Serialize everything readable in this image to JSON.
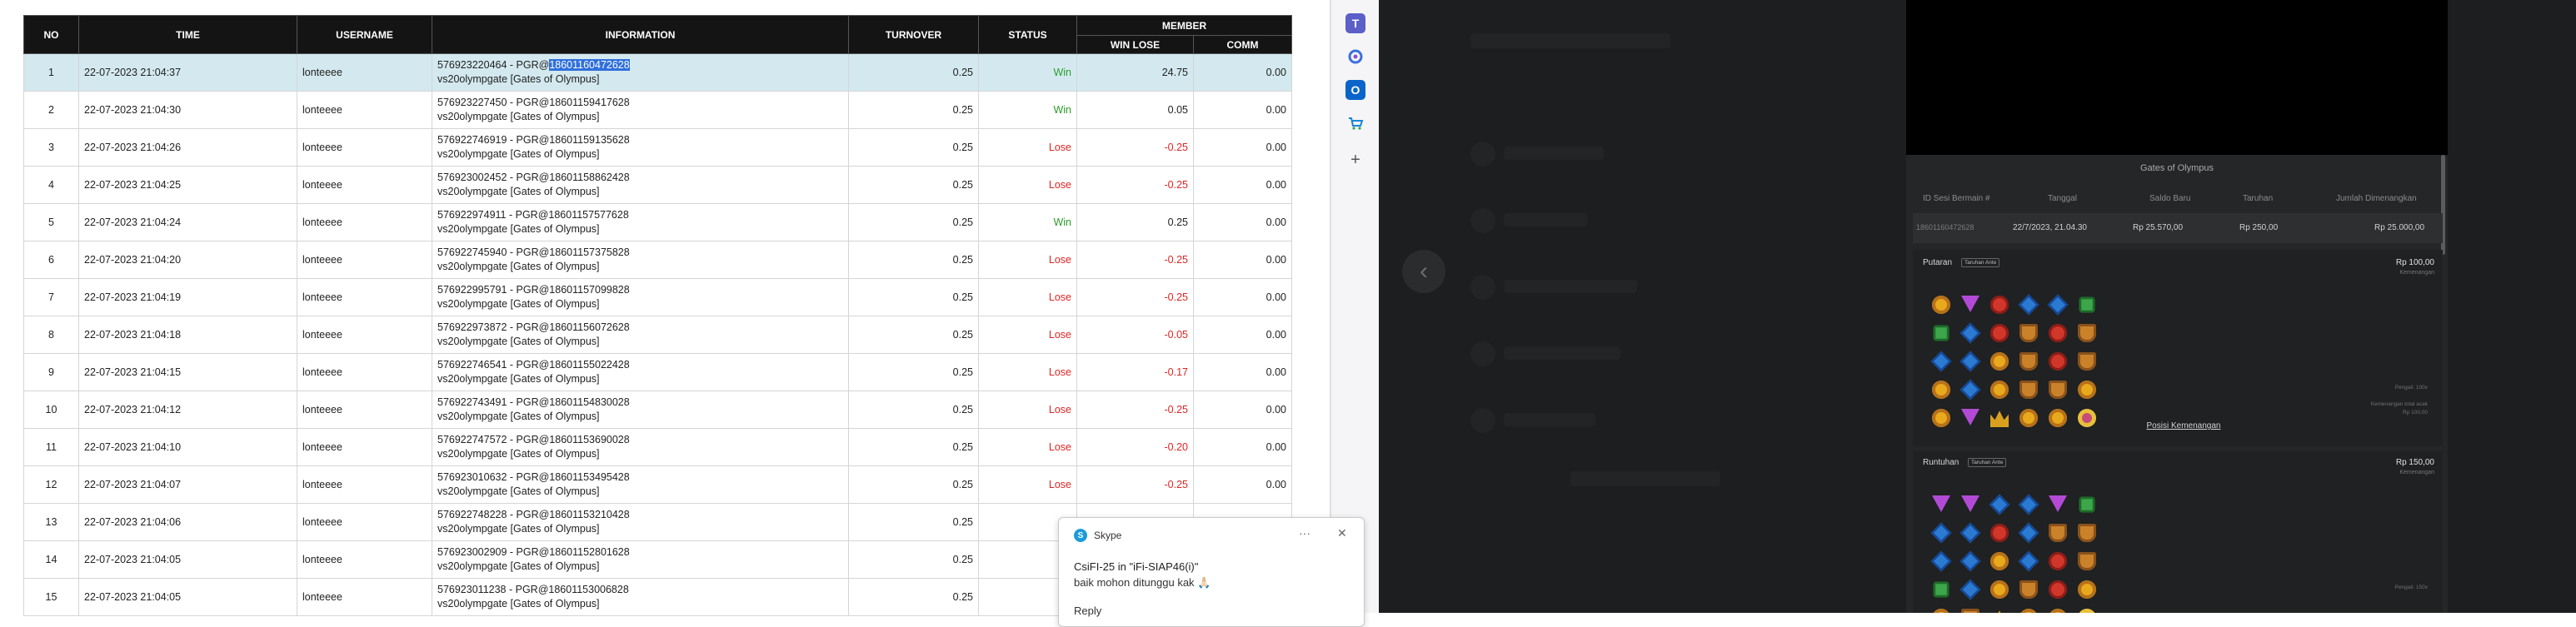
{
  "report": {
    "headers": {
      "no": "NO",
      "time": "TIME",
      "username": "USERNAME",
      "information": "INFORMATION",
      "turnover": "TURNOVER",
      "status": "STATUS",
      "member": "MEMBER",
      "win_lose": "WIN LOSE",
      "comm": "COMM"
    },
    "rows": [
      {
        "no": "1",
        "time": "22-07-2023 21:04:37",
        "username": "lonteeee",
        "info_prefix": "576923220464 - PGR@",
        "info_highlight": "18601160472628",
        "info_line2": "vs20olympgate [Gates of Olympus]",
        "turnover": "0.25",
        "status": "Win",
        "win_lose": "24.75",
        "comm": "0.00"
      },
      {
        "no": "2",
        "time": "22-07-2023 21:04:30",
        "username": "lonteeee",
        "info_prefix": "576923227450 - PGR@18601159417628",
        "info_highlight": "",
        "info_line2": "vs20olympgate [Gates of Olympus]",
        "turnover": "0.25",
        "status": "Win",
        "win_lose": "0.05",
        "comm": "0.00"
      },
      {
        "no": "3",
        "time": "22-07-2023 21:04:26",
        "username": "lonteeee",
        "info_prefix": "576922746919 - PGR@18601159135628",
        "info_highlight": "",
        "info_line2": "vs20olympgate [Gates of Olympus]",
        "turnover": "0.25",
        "status": "Lose",
        "win_lose": "-0.25",
        "comm": "0.00"
      },
      {
        "no": "4",
        "time": "22-07-2023 21:04:25",
        "username": "lonteeee",
        "info_prefix": "576923002452 - PGR@18601158862428",
        "info_highlight": "",
        "info_line2": "vs20olympgate [Gates of Olympus]",
        "turnover": "0.25",
        "status": "Lose",
        "win_lose": "-0.25",
        "comm": "0.00"
      },
      {
        "no": "5",
        "time": "22-07-2023 21:04:24",
        "username": "lonteeee",
        "info_prefix": "576922974911 - PGR@18601157577628",
        "info_highlight": "",
        "info_line2": "vs20olympgate [Gates of Olympus]",
        "turnover": "0.25",
        "status": "Win",
        "win_lose": "0.25",
        "comm": "0.00"
      },
      {
        "no": "6",
        "time": "22-07-2023 21:04:20",
        "username": "lonteeee",
        "info_prefix": "576922745940 - PGR@18601157375828",
        "info_highlight": "",
        "info_line2": "vs20olympgate [Gates of Olympus]",
        "turnover": "0.25",
        "status": "Lose",
        "win_lose": "-0.25",
        "comm": "0.00"
      },
      {
        "no": "7",
        "time": "22-07-2023 21:04:19",
        "username": "lonteeee",
        "info_prefix": "576922995791 - PGR@18601157099828",
        "info_highlight": "",
        "info_line2": "vs20olympgate [Gates of Olympus]",
        "turnover": "0.25",
        "status": "Lose",
        "win_lose": "-0.25",
        "comm": "0.00"
      },
      {
        "no": "8",
        "time": "22-07-2023 21:04:18",
        "username": "lonteeee",
        "info_prefix": "576922973872 - PGR@18601156072628",
        "info_highlight": "",
        "info_line2": "vs20olympgate [Gates of Olympus]",
        "turnover": "0.25",
        "status": "Lose",
        "win_lose": "-0.05",
        "comm": "0.00"
      },
      {
        "no": "9",
        "time": "22-07-2023 21:04:15",
        "username": "lonteeee",
        "info_prefix": "576922746541 - PGR@18601155022428",
        "info_highlight": "",
        "info_line2": "vs20olympgate [Gates of Olympus]",
        "turnover": "0.25",
        "status": "Lose",
        "win_lose": "-0.17",
        "comm": "0.00"
      },
      {
        "no": "10",
        "time": "22-07-2023 21:04:12",
        "username": "lonteeee",
        "info_prefix": "576922743491 - PGR@18601154830028",
        "info_highlight": "",
        "info_line2": "vs20olympgate [Gates of Olympus]",
        "turnover": "0.25",
        "status": "Lose",
        "win_lose": "-0.25",
        "comm": "0.00"
      },
      {
        "no": "11",
        "time": "22-07-2023 21:04:10",
        "username": "lonteeee",
        "info_prefix": "576922747572 - PGR@18601153690028",
        "info_highlight": "",
        "info_line2": "vs20olympgate [Gates of Olympus]",
        "turnover": "0.25",
        "status": "Lose",
        "win_lose": "-0.20",
        "comm": "0.00"
      },
      {
        "no": "12",
        "time": "22-07-2023 21:04:07",
        "username": "lonteeee",
        "info_prefix": "576923010632 - PGR@18601153495428",
        "info_highlight": "",
        "info_line2": "vs20olympgate [Gates of Olympus]",
        "turnover": "0.25",
        "status": "Lose",
        "win_lose": "-0.25",
        "comm": "0.00"
      },
      {
        "no": "13",
        "time": "22-07-2023 21:04:06",
        "username": "lonteeee",
        "info_prefix": "576922748228 - PGR@18601153210428",
        "info_highlight": "",
        "info_line2": "vs20olympgate [Gates of Olympus]",
        "turnover": "0.25",
        "status": "L",
        "win_lose": "",
        "comm": ""
      },
      {
        "no": "14",
        "time": "22-07-2023 21:04:05",
        "username": "lonteeee",
        "info_prefix": "576923002909 - PGR@18601152801628",
        "info_highlight": "",
        "info_line2": "vs20olympgate [Gates of Olympus]",
        "turnover": "0.25",
        "status": "L",
        "win_lose": "",
        "comm": ""
      },
      {
        "no": "15",
        "time": "22-07-2023 21:04:05",
        "username": "lonteeee",
        "info_prefix": "576923011238 - PGR@18601153006828",
        "info_highlight": "",
        "info_line2": "vs20olympgate [Gates of Olympus]",
        "turnover": "0.25",
        "status": "L",
        "win_lose": "",
        "comm": ""
      }
    ]
  },
  "sidebar": {
    "icons": [
      "teams-icon",
      "copilot-icon",
      "outlook-icon",
      "shopping-icon",
      "add-icon"
    ],
    "add_symbol": "+"
  },
  "game": {
    "title": "Gates of Olympus",
    "columns": [
      "ID Sesi Bermain #",
      "Tanggal",
      "Saldo Baru",
      "Taruhan",
      "Jumlah Dimenangkan"
    ],
    "row": [
      "18601160472628",
      "22/7/2023, 21.04.30",
      "Rp 25.570,00",
      "Rp 250,00",
      "Rp 25.000,00"
    ],
    "section1": {
      "title": "Putaran",
      "badge": "Taruhan Ante",
      "amount": "Rp 100,00",
      "sub": "Kemenangan",
      "note1": "Pengali: 100x",
      "note2": "Kemenangan total acak",
      "note3": "Rp 100,00"
    },
    "position_link": "Posisi Kemenangan",
    "section2": {
      "title": "Runtuhan",
      "badge": "Taruhan Ante",
      "amount": "Rp 150,00",
      "sub": "Kemenangan",
      "note1": "Pengali: 150x"
    }
  },
  "toast": {
    "app": "Skype",
    "logo_letter": "S",
    "more": "···",
    "close": "✕",
    "title": "CsiFI-25 in \"iFi-SIAP46(i)\"",
    "message": "baik mohon ditunggu kak 🙏🏻",
    "extra": "Reply"
  },
  "colors": {
    "header_bg": "#141414",
    "selected_row": "#d3e9ef",
    "win": "#2a9d2a",
    "lose": "#e02424",
    "highlight": "#2f6fdb"
  }
}
